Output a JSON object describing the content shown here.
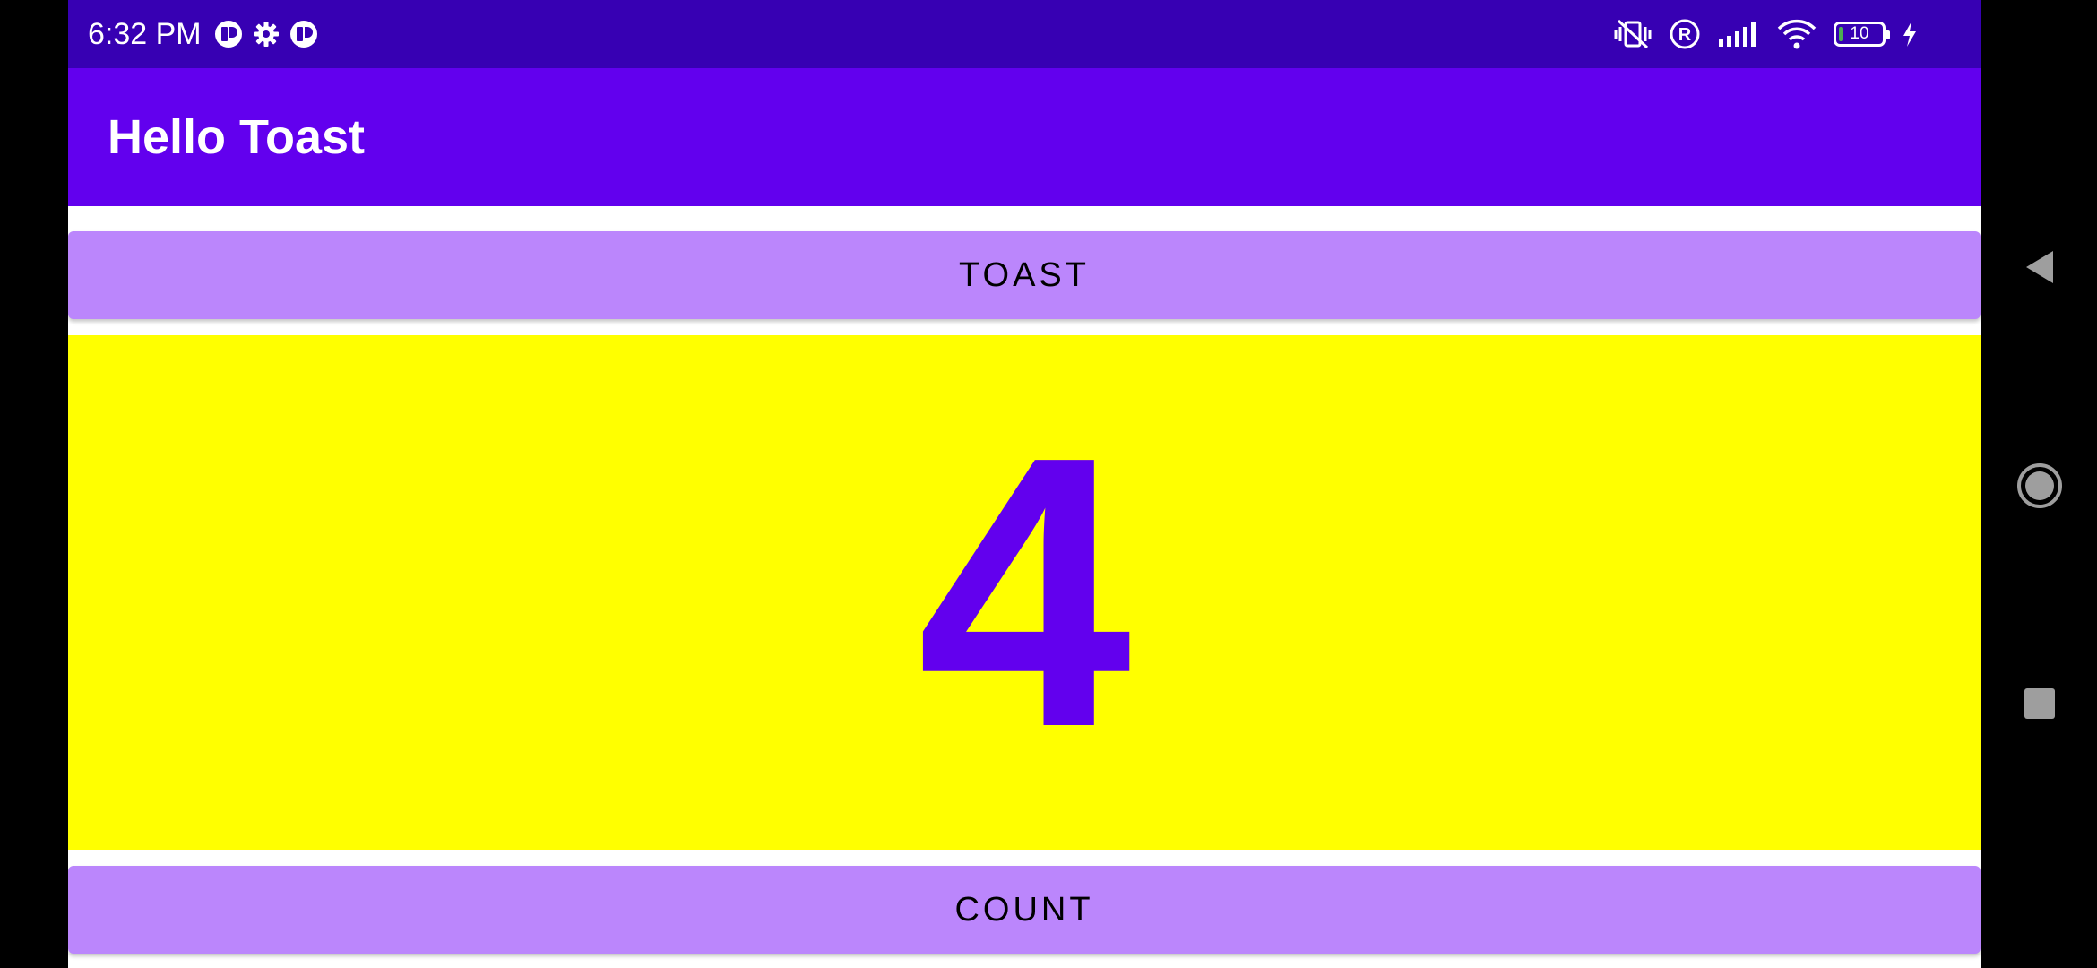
{
  "status_bar": {
    "time": "6:32 PM",
    "left_icons": [
      "app-notification-icon",
      "settings-gear-icon",
      "app-notification-icon"
    ],
    "right_icons": [
      "vibrate-off-icon",
      "registered-icon",
      "signal-icon",
      "wifi-icon",
      "battery-icon",
      "charging-bolt-icon"
    ],
    "battery_level": "10",
    "battery_fraction": 0.1
  },
  "app_bar": {
    "title": "Hello Toast",
    "color": "#6200EE"
  },
  "buttons": {
    "toast_label": "TOAST",
    "count_label": "COUNT",
    "color": "#BB86FC"
  },
  "count_panel": {
    "value": "4",
    "background": "#FFFF00",
    "text_color": "#6200EE"
  },
  "nav_bar": {
    "icons": [
      "back-triangle-icon",
      "home-circle-icon",
      "recents-square-icon"
    ]
  }
}
